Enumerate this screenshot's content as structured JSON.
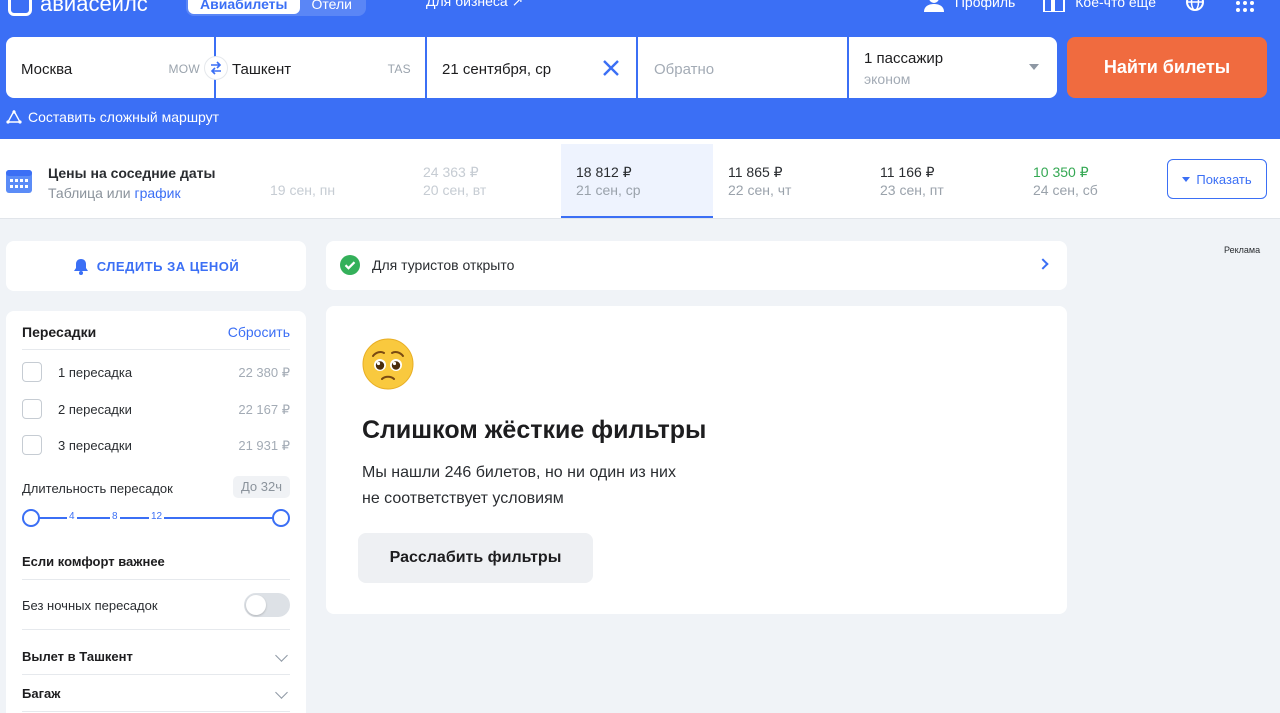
{
  "header": {
    "logo_text": "авиасейлс",
    "tabs": [
      {
        "label": "Авиабилеты",
        "active": true
      },
      {
        "label": "Отели",
        "active": false
      }
    ],
    "business_link": "Для бизнеса ↗",
    "profile_label": "Профиль",
    "more_label": "Кое-что ещё"
  },
  "search": {
    "origin_city": "Москва",
    "origin_code": "MOW",
    "destination_city": "Ташкент",
    "destination_code": "TAS",
    "depart_date": "21 сентября, ср",
    "return_placeholder": "Обратно",
    "passengers": "1 пассажир",
    "cabin_class": "эконом",
    "search_button": "Найти билеты",
    "complex_route": "Составить сложный маршрут"
  },
  "nearby_dates": {
    "title": "Цены на соседние даты",
    "subtitle_prefix": "Таблица или ",
    "subtitle_link": "график",
    "days": [
      {
        "price": "",
        "date": "19 сен, пн",
        "state": "faded"
      },
      {
        "price": "24 363 ₽",
        "date": "20 сен, вт",
        "state": "faded"
      },
      {
        "price": "18 812 ₽",
        "date": "21 сен, ср",
        "state": "selected"
      },
      {
        "price": "11 865 ₽",
        "date": "22 сен, чт",
        "state": "normal"
      },
      {
        "price": "11 166 ₽",
        "date": "23 сен, пт",
        "state": "normal"
      },
      {
        "price": "10 350 ₽",
        "date": "24 сен, сб",
        "state": "green"
      }
    ],
    "show_button": "Показать"
  },
  "sidebar": {
    "follow_price": "СЛЕДИТЬ ЗА ЦЕНОЙ",
    "transfers_title": "Пересадки",
    "reset": "Сбросить",
    "transfer_options": [
      {
        "label": "1 пересадка",
        "price": "22 380 ₽"
      },
      {
        "label": "2 пересадки",
        "price": "22 167 ₽"
      },
      {
        "label": "3 пересадки",
        "price": "21 931 ₽"
      }
    ],
    "duration_label": "Длительность пересадок",
    "duration_value": "До 32ч",
    "slider_ticks": [
      "4",
      "8",
      "12"
    ],
    "comfort_title": "Если комфорт важнее",
    "no_night_label": "Без ночных пересадок",
    "departure_title": "Вылет в Ташкент",
    "baggage_title": "Багаж"
  },
  "main": {
    "notice": "Для туристов открыто",
    "empty_title": "Слишком жёсткие фильтры",
    "empty_desc_line1": "Мы нашли 246 билетов, но ни один из них",
    "empty_desc_line2": "не соответствует условиям",
    "relax_button": "Расслабить фильтры",
    "ad_label": "Реклама"
  },
  "colors": {
    "brand_blue": "#3b6ff5",
    "search_orange": "#f06b3f",
    "success_green": "#34a853"
  }
}
